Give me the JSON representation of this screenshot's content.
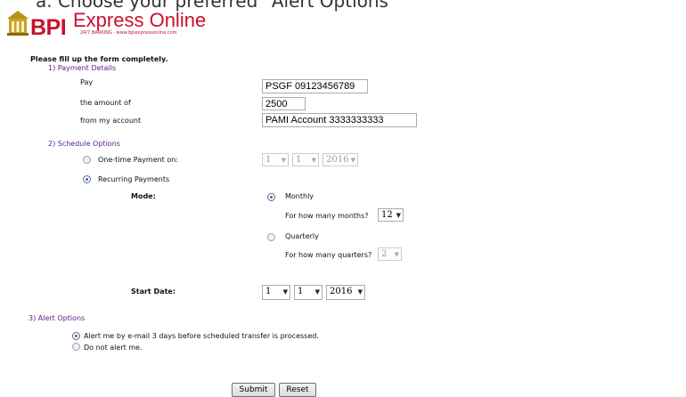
{
  "caption": "a.  Choose your preferred \"Alert Options\"",
  "logo": {
    "brand": "BPI",
    "title": "Express Online",
    "tagline": "24/7 BANKING · www.bpiexpressonline.com"
  },
  "form": {
    "instruction": "Please fill up the form completely.",
    "payment": {
      "heading": "1)  Payment Details",
      "pay_label": "Pay",
      "pay_value": "PSGF 09123456789",
      "amount_label": "the amount of",
      "amount_value": "2500",
      "account_label": "from my account",
      "account_value": "PAMI Account 3333333333"
    },
    "schedule": {
      "heading": "2)  Schedule Options",
      "onetime_label": "One-time Payment on:",
      "onetime_month": "1",
      "onetime_day": "1",
      "onetime_year": "2016",
      "recurring_label": "Recurring Payments",
      "mode_label": "Mode:",
      "monthly_label": "Monthly",
      "months_question": "For how many months?",
      "months_value": "12",
      "quarterly_label": "Quarterly",
      "quarters_question": "For how many quarters?",
      "quarters_value": "2",
      "start_label": "Start Date:",
      "start_month": "1",
      "start_day": "1",
      "start_year": "2016"
    },
    "alert": {
      "heading": "3)  Alert Options",
      "option_email": "Alert me by e-mail 3 days before scheduled transfer is processed.",
      "option_none": "Do not alert me."
    }
  },
  "buttons": {
    "submit": "Submit",
    "reset": "Reset"
  },
  "colors": {
    "brand_red": "#c8102e",
    "section_purple": "#5a1a8c"
  }
}
